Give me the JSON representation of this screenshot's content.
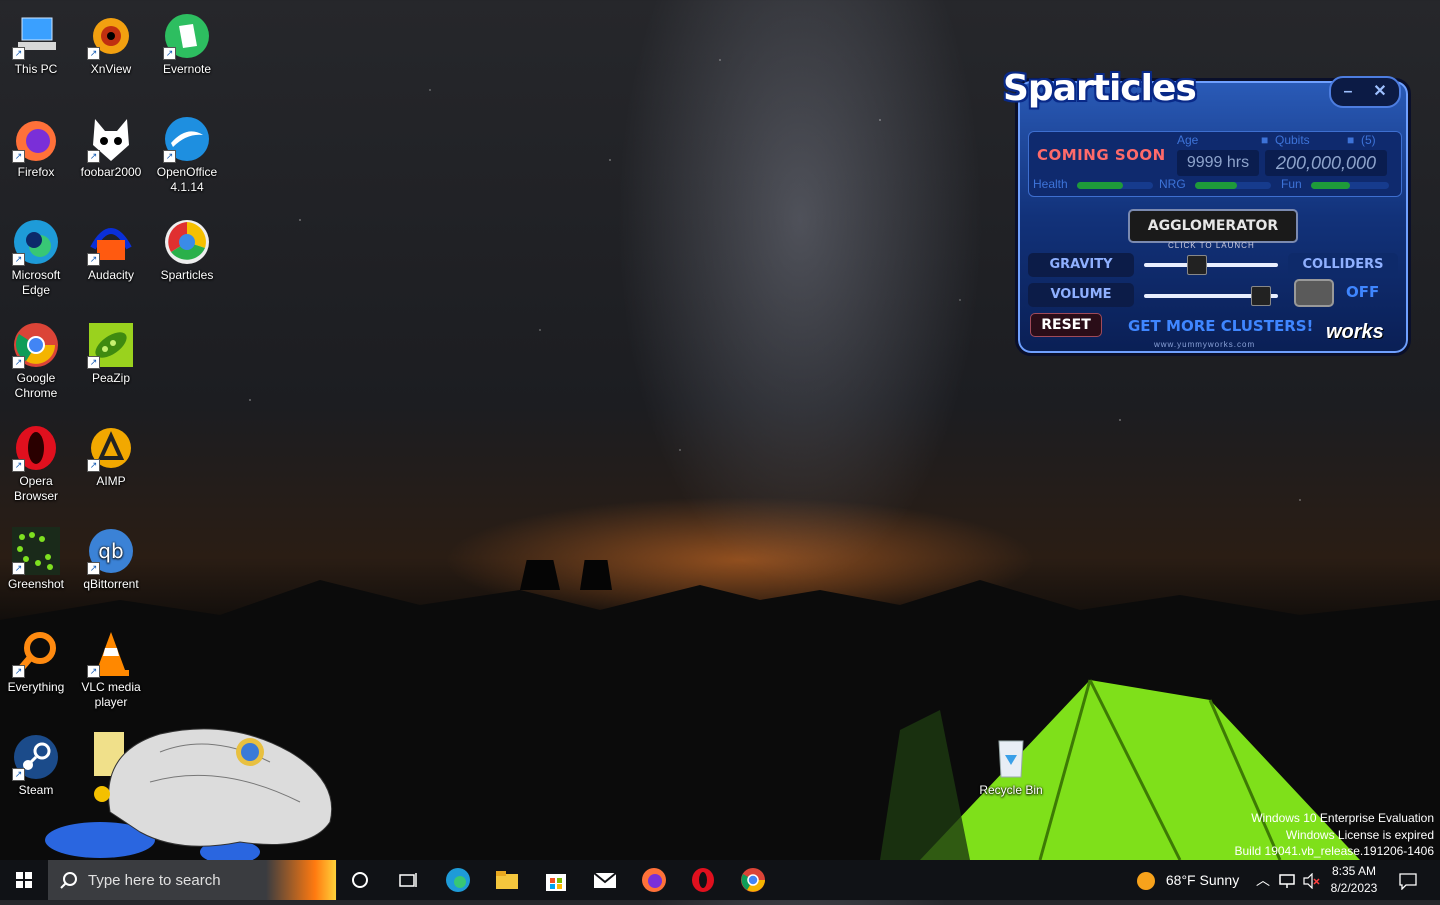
{
  "desktop": {
    "icons": [
      {
        "label": "This PC"
      },
      {
        "label": "XnView"
      },
      {
        "label": "Evernote"
      },
      {
        "label": "Firefox"
      },
      {
        "label": "foobar2000"
      },
      {
        "label": "OpenOffice 4.1.14"
      },
      {
        "label": "Microsoft Edge"
      },
      {
        "label": "Audacity"
      },
      {
        "label": "Sparticles"
      },
      {
        "label": "Google Chrome"
      },
      {
        "label": "PeaZip"
      },
      {
        "label": "Opera Browser"
      },
      {
        "label": "AIMP"
      },
      {
        "label": "Greenshot"
      },
      {
        "label": "qBittorrent"
      },
      {
        "label": "Everything"
      },
      {
        "label": "VLC media player"
      },
      {
        "label": "Steam"
      },
      {
        "label": "Recycle Bin"
      }
    ]
  },
  "sparticles": {
    "title": "Sparticles",
    "coming_soon": "COMING SOON",
    "age_label": "Age",
    "age_value": "9999 hrs",
    "qubits_label": "Qubits",
    "qubits_value": "200,000,000",
    "count_label": "(5)",
    "health_label": "Health",
    "nrg_label": "NRG",
    "fun_label": "Fun",
    "health_level": 0.6,
    "nrg_level": 0.55,
    "fun_level": 0.5,
    "agglomerator_label": "AGGLOMERATOR",
    "click_hint": "CLICK TO LAUNCH",
    "gravity_label": "GRAVITY",
    "volume_label": "VOLUME",
    "colliders_label": "COLLIDERS",
    "colliders_state": "OFF",
    "gravity_level": 0.37,
    "volume_level": 0.92,
    "reset_label": "RESET",
    "get_more_label": "GET MORE CLUSTERS!",
    "url": "www.yummyworks.com",
    "brand": "works"
  },
  "watermark": {
    "line1": "Windows 10 Enterprise Evaluation",
    "line2": "Windows License is expired",
    "line3": "Build 19041.vb_release.191206-1406"
  },
  "taskbar": {
    "search_placeholder": "Type here to search",
    "weather": "68°F  Sunny",
    "time": "8:35 AM",
    "date": "8/2/2023"
  }
}
